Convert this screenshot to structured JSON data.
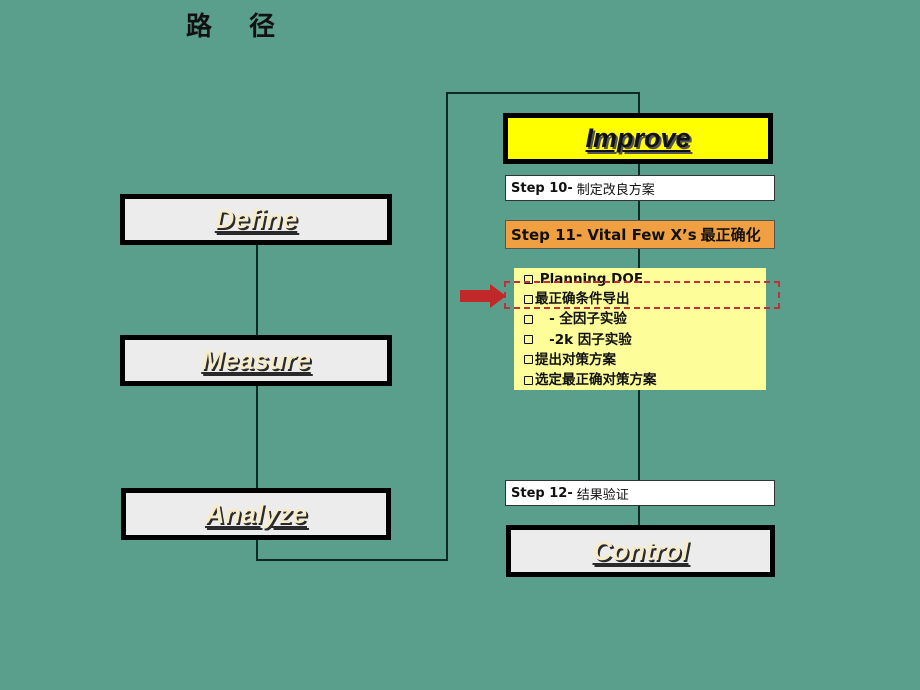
{
  "page": {
    "title": "路 径",
    "background_color": "#5a9f8b"
  },
  "phases": {
    "define": "Define",
    "measure": "Measure",
    "analyze": "Analyze",
    "improve": "Improve",
    "control": "Control"
  },
  "steps": [
    {
      "id": "step10",
      "prefix": "Step 10-",
      "text": "制定改良方案"
    },
    {
      "id": "step11",
      "prefix": "Step 11- Vital Few X’s",
      "text": "最正确化",
      "highlighted": true
    },
    {
      "id": "step12",
      "prefix": "Step 12-",
      "text": "结果验证"
    }
  ],
  "checklist": {
    "items": [
      " Planning DOE",
      "最正确条件导出",
      "   - 全因子实验",
      "   -2k 因子实验",
      "提出对策方案",
      "选定最正确对策方案"
    ],
    "focused_item_index": 1
  },
  "colors": {
    "improve_fill": "#ffff00",
    "step11_fill": "#f0a040",
    "checklist_fill": "#fdfd9a",
    "focus_dash": "#c0303a",
    "arrow": "#c0282a"
  }
}
